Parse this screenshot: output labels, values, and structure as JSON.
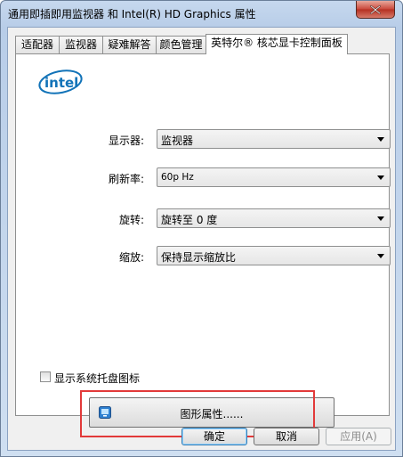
{
  "window": {
    "title": "通用即插即用监视器 和 Intel(R) HD Graphics 属性",
    "close_icon": "close-icon"
  },
  "tabs": [
    {
      "label": "适配器",
      "active": false
    },
    {
      "label": "监视器",
      "active": false
    },
    {
      "label": "疑难解答",
      "active": false
    },
    {
      "label": "颜色管理",
      "active": false
    },
    {
      "label": "英特尔® 核芯显卡控制面板",
      "active": true
    }
  ],
  "panel": {
    "logo_text": "intel",
    "display": {
      "label": "显示器:",
      "value": "监视器"
    },
    "refresh": {
      "label": "刷新率:",
      "value": "60p Hz"
    },
    "rotation": {
      "label": "旋转:",
      "value": "旋转至 0 度"
    },
    "scaling": {
      "label": "缩放:",
      "value": "保持显示缩放比"
    },
    "tray_checkbox": {
      "label": "显示系统托盘图标",
      "checked": false
    },
    "graphics_button": {
      "label": "图形属性......"
    }
  },
  "footer": {
    "ok_label": "确定",
    "cancel_label": "取消",
    "apply_label": "应用(A)"
  },
  "colors": {
    "highlight": "#e23a3a",
    "intel_blue": "#1273b8"
  }
}
